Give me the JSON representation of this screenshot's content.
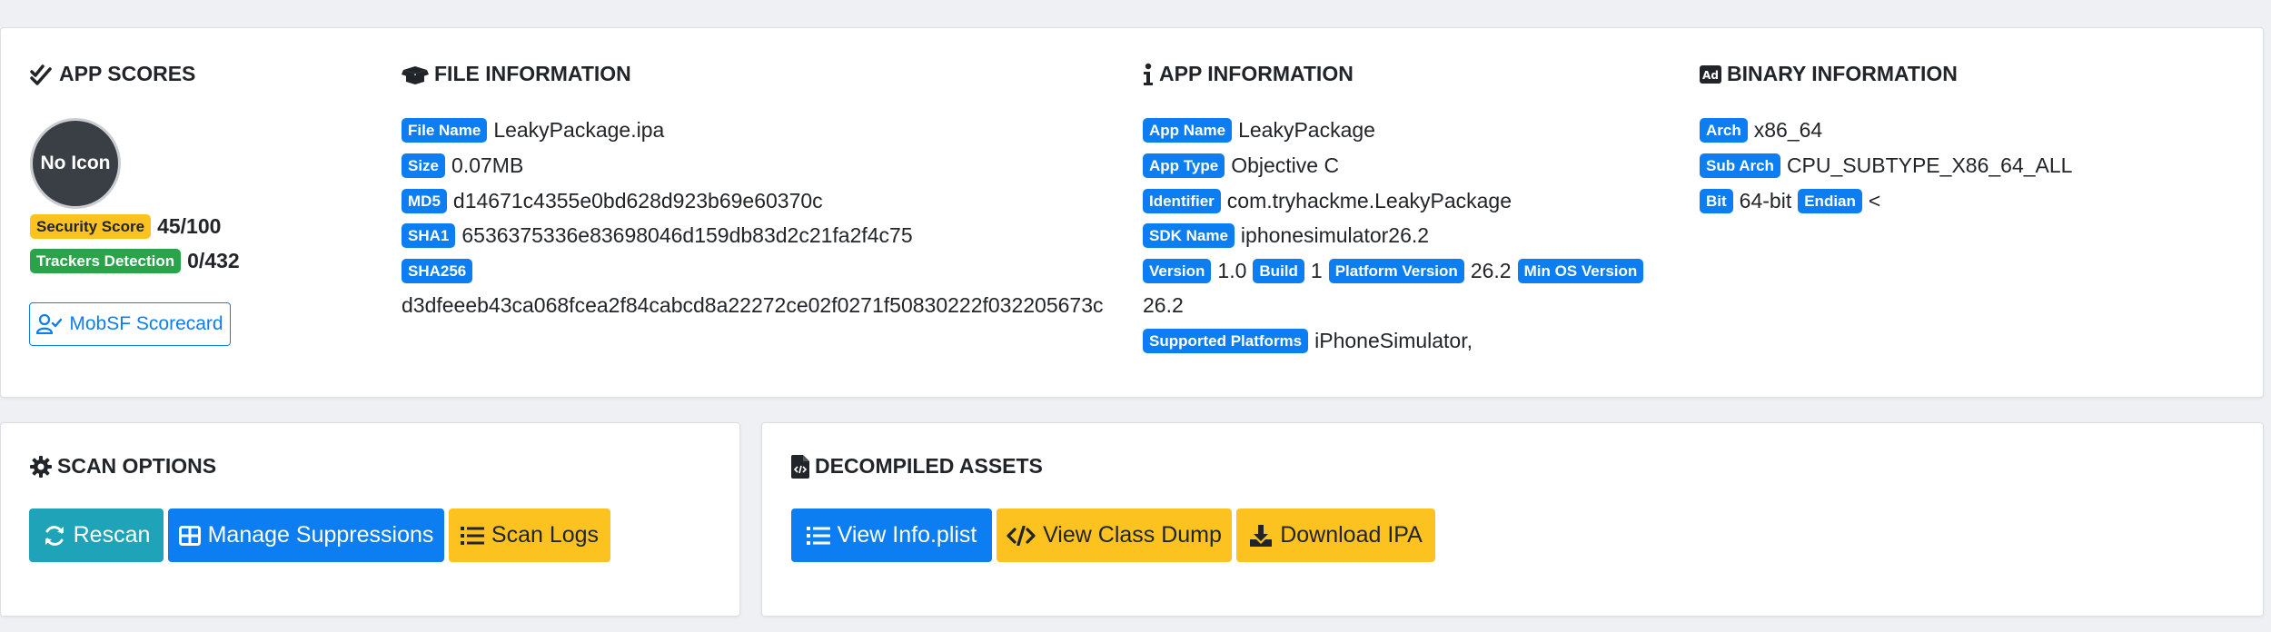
{
  "app_scores": {
    "title": "APP SCORES",
    "avatar_text": "No Icon",
    "security_score_label": "Security Score",
    "security_score_value": "45/100",
    "trackers_label": "Trackers Detection",
    "trackers_value": "0/432",
    "scorecard_button": "MobSF Scorecard"
  },
  "file_info": {
    "title": "FILE INFORMATION",
    "rows": [
      {
        "label": "File Name",
        "value": "LeakyPackage.ipa"
      },
      {
        "label": "Size",
        "value": "0.07MB"
      },
      {
        "label": "MD5",
        "value": "d14671c4355e0bd628d923b69e60370c"
      },
      {
        "label": "SHA1",
        "value": "6536375336e83698046d159db83d2c21fa2f4c75"
      },
      {
        "label": "SHA256",
        "value": "d3dfeeeb43ca068fcea2f84cabcd8a22272ce02f0271f50830222f032205673c"
      }
    ]
  },
  "app_info": {
    "title": "APP INFORMATION",
    "app_name_label": "App Name",
    "app_name": "LeakyPackage",
    "app_type_label": "App Type",
    "app_type": "Objective C",
    "identifier_label": "Identifier",
    "identifier": "com.tryhackme.LeakyPackage",
    "sdk_name_label": "SDK Name",
    "sdk_name": "iphonesimulator26.2",
    "version_label": "Version",
    "version": "1.0",
    "build_label": "Build",
    "build": "1",
    "platform_version_label": "Platform Version",
    "platform_version": "26.2",
    "min_os_label": "Min OS Version",
    "min_os": "26.2",
    "supported_platforms_label": "Supported Platforms",
    "supported_platforms": "iPhoneSimulator,"
  },
  "binary_info": {
    "title": "BINARY INFORMATION",
    "arch_label": "Arch",
    "arch": "x86_64",
    "sub_arch_label": "Sub Arch",
    "sub_arch": "CPU_SUBTYPE_X86_64_ALL",
    "bit_label": "Bit",
    "bit": "64-bit",
    "endian_label": "Endian",
    "endian": "<"
  },
  "scan_options": {
    "title": "SCAN OPTIONS",
    "rescan": "Rescan",
    "manage_suppressions": "Manage Suppressions",
    "scan_logs": "Scan Logs"
  },
  "decompiled_assets": {
    "title": "DECOMPILED ASSETS",
    "view_info_plist": "View Info.plist",
    "view_class_dump": "View Class Dump",
    "download_ipa": "Download IPA"
  },
  "colors": {
    "primary": "#0d7ef2",
    "warning": "#fcc21f",
    "success": "#2aa44b",
    "info": "#1ea3b8",
    "background": "#eef0f4"
  }
}
